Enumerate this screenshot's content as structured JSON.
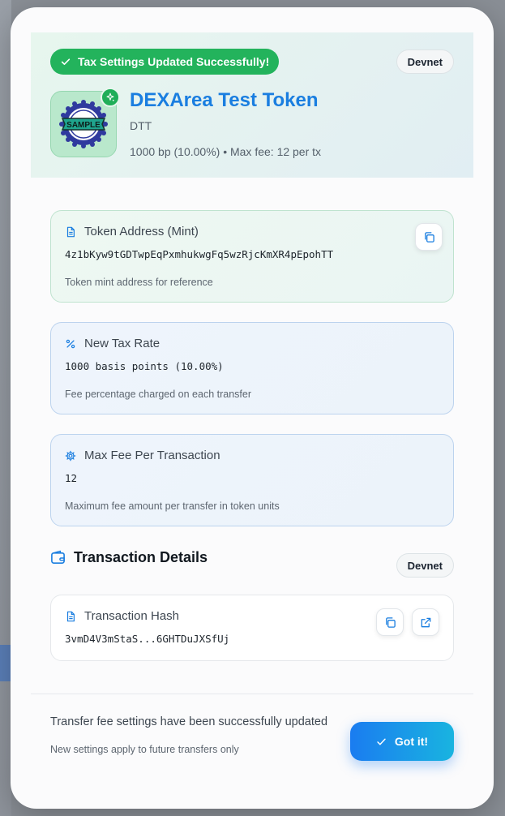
{
  "header": {
    "success_message": "Tax Settings Updated Successfully!",
    "network_badge": "Devnet",
    "token_logo_text": "SAMPLE",
    "token_name": "DEXArea Test Token",
    "token_symbol": "DTT",
    "fee_summary": "1000 bp (10.00%) • Max fee: 12 per tx"
  },
  "cards": {
    "token_address": {
      "title": "Token Address (Mint)",
      "value": "4z1bKyw9tGDTwpEqPxmhukwgFq5wzRjcKmXR4pEpohTT",
      "note": "Token mint address for reference"
    },
    "tax_rate": {
      "title": "New Tax Rate",
      "value": "1000 basis points (10.00%)",
      "note": "Fee percentage charged on each transfer"
    },
    "max_fee": {
      "title": "Max Fee Per Transaction",
      "value": "12",
      "note": "Maximum fee amount per transfer in token units"
    }
  },
  "transaction": {
    "section_title": "Transaction Details",
    "network_badge": "Devnet",
    "hash_title": "Transaction Hash",
    "hash_value": "3vmD4V3mStaS...6GHTDuJXSfUj"
  },
  "footer": {
    "main_text": "Transfer fee settings have been successfully updated",
    "sub_text": "New settings apply to future transfers only",
    "button_label": "Got it!"
  },
  "colors": {
    "success": "#23b35c",
    "accent_blue": "#1a7ee0",
    "button_gradient_start": "#1a7cf0",
    "button_gradient_end": "#19b4e0"
  }
}
